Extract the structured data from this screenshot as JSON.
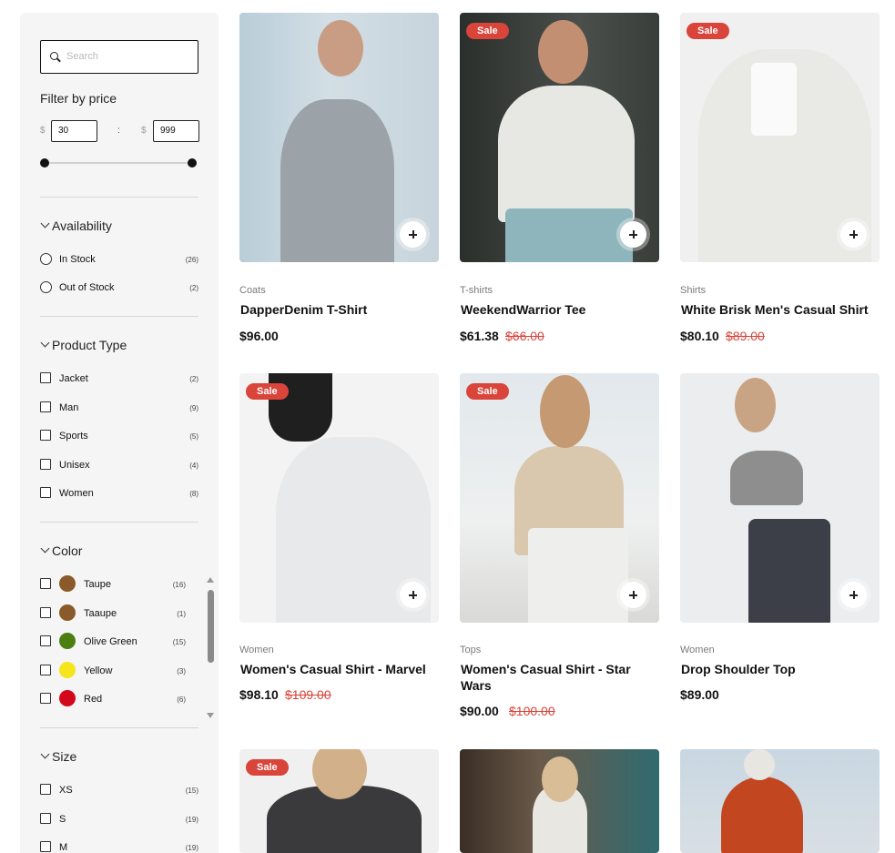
{
  "sidebar": {
    "search": {
      "placeholder": "Search"
    },
    "price_filter": {
      "title": "Filter by price",
      "currency": "$",
      "min": "30",
      "separator": ":",
      "max": "999"
    },
    "availability": {
      "title": "Availability",
      "items": [
        {
          "label": "In Stock",
          "count": "(26)"
        },
        {
          "label": "Out of Stock",
          "count": "(2)"
        }
      ]
    },
    "product_type": {
      "title": "Product Type",
      "items": [
        {
          "label": "Jacket",
          "count": "(2)"
        },
        {
          "label": "Man",
          "count": "(9)"
        },
        {
          "label": "Sports",
          "count": "(5)"
        },
        {
          "label": "Unisex",
          "count": "(4)"
        },
        {
          "label": "Women",
          "count": "(8)"
        }
      ]
    },
    "color": {
      "title": "Color",
      "items": [
        {
          "label": "Taupe",
          "count": "(16)",
          "swatch": "#8a5a2b"
        },
        {
          "label": "Taaupe",
          "count": "(1)",
          "swatch": "#8a5a2b"
        },
        {
          "label": "Olive Green",
          "count": "(15)",
          "swatch": "#4b7f12"
        },
        {
          "label": "Yellow",
          "count": "(3)",
          "swatch": "#f5e51c"
        },
        {
          "label": "Red",
          "count": "(6)",
          "swatch": "#d3081b"
        }
      ]
    },
    "size": {
      "title": "Size",
      "items": [
        {
          "label": "XS",
          "count": "(15)"
        },
        {
          "label": "S",
          "count": "(19)"
        },
        {
          "label": "M",
          "count": "(19)"
        }
      ]
    }
  },
  "products": [
    {
      "category": "Coats",
      "name": "DapperDenim T-Shirt",
      "price": "$96.00",
      "old_price": "",
      "badge": ""
    },
    {
      "category": "T-shirts",
      "name": "WeekendWarrior Tee",
      "price": "$61.38",
      "old_price": "$66.00",
      "badge": "Sale"
    },
    {
      "category": "Shirts",
      "name": "White Brisk Men's Casual Shirt",
      "price": "$80.10",
      "old_price": "$89.00",
      "badge": "Sale"
    },
    {
      "category": "Women",
      "name": "Women's Casual Shirt - Marvel",
      "price": "$98.10",
      "old_price": "$109.00",
      "badge": "Sale"
    },
    {
      "category": "Tops",
      "name": "Women's Casual Shirt - Star Wars",
      "price": "$90.00",
      "old_price": "$100.00",
      "badge": "Sale"
    },
    {
      "category": "Women",
      "name": "Drop Shoulder Top",
      "price": "$89.00",
      "old_price": "",
      "badge": ""
    },
    {
      "badge": "Sale"
    },
    {
      "badge": ""
    },
    {
      "badge": ""
    }
  ],
  "colors": {
    "sale": "#d9443b",
    "sidebar_bg": "#f5f5f5"
  }
}
